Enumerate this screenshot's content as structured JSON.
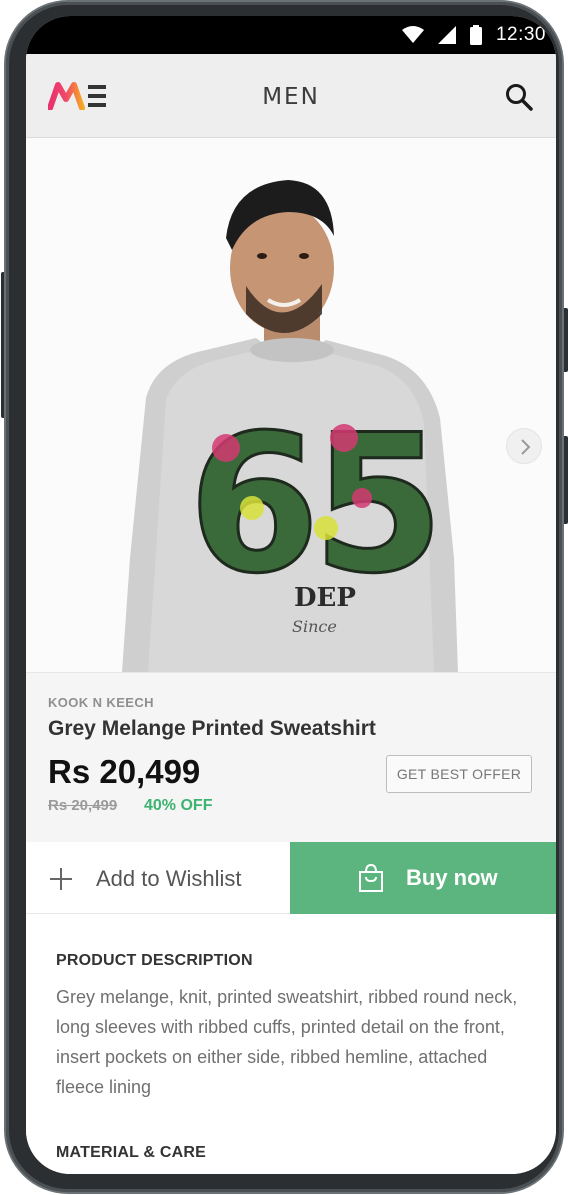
{
  "status_bar": {
    "time": "12:30"
  },
  "app_bar": {
    "title": "MEN",
    "logo_colors": [
      "#e8336e",
      "#f5a623"
    ],
    "search_icon": "search-icon"
  },
  "product": {
    "brand": "KOOK N KEECH",
    "name": "Grey Melange Printed Sweatshirt",
    "price": "Rs 20,499",
    "mrp": "Rs 20,499",
    "discount": "40% OFF",
    "offer_button": "GET BEST OFFER",
    "image_print_text": "65"
  },
  "actions": {
    "wishlist_label": "Add to Wishlist",
    "buy_label": "Buy now",
    "buy_color": "#5cb57f"
  },
  "description": {
    "heading": "PRODUCT DESCRIPTION",
    "text": "Grey melange, knit, printed sweatshirt, ribbed round neck, long sleeves with ribbed cuffs, printed detail on the front, insert pockets on either side, ribbed hemline, attached fleece lining",
    "care_heading": "MATERIAL & CARE"
  }
}
